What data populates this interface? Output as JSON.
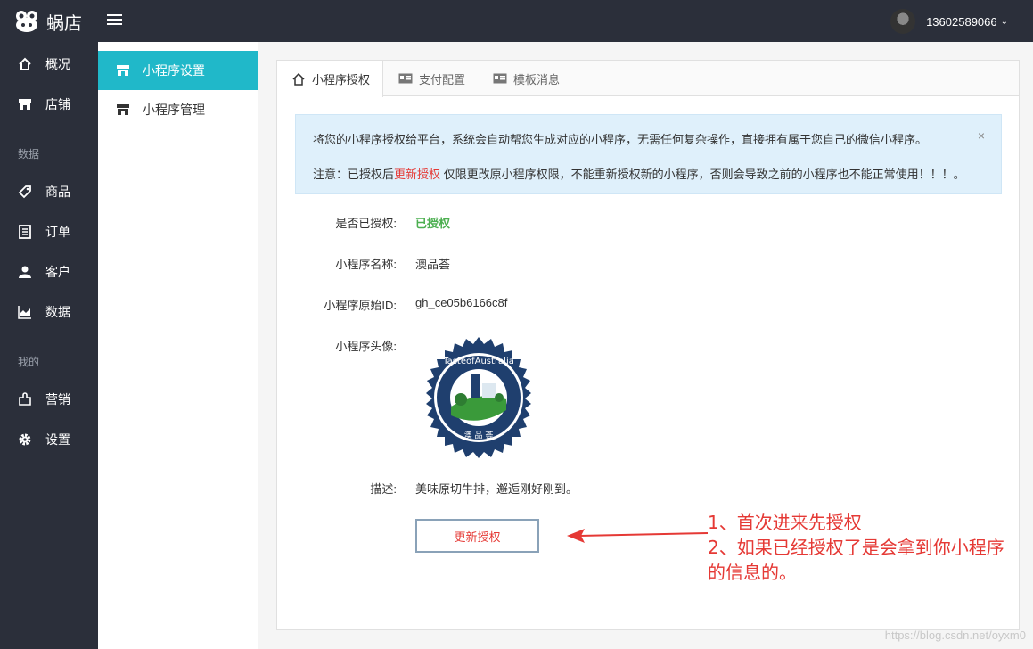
{
  "app": {
    "name": "蜗店"
  },
  "user": {
    "phone": "13602589066"
  },
  "sidebar": {
    "items": [
      {
        "label": "概况",
        "icon": "home-icon"
      },
      {
        "label": "店铺",
        "icon": "store-icon"
      }
    ],
    "section_data": "数据",
    "data_items": [
      {
        "label": "商品",
        "icon": "tag-icon"
      },
      {
        "label": "订单",
        "icon": "order-icon"
      },
      {
        "label": "客户",
        "icon": "user-icon"
      },
      {
        "label": "数据",
        "icon": "chart-icon"
      }
    ],
    "section_mine": "我的",
    "mine_items": [
      {
        "label": "营销",
        "icon": "puzzle-icon"
      },
      {
        "label": "设置",
        "icon": "gear-icon"
      }
    ]
  },
  "subnav": {
    "items": [
      {
        "label": "小程序设置",
        "active": true
      },
      {
        "label": "小程序管理",
        "active": false
      }
    ]
  },
  "tabs": [
    {
      "label": "小程序授权",
      "icon": "home-icon",
      "active": true
    },
    {
      "label": "支付配置",
      "icon": "card-icon",
      "active": false
    },
    {
      "label": "模板消息",
      "icon": "card-icon",
      "active": false
    }
  ],
  "alert": {
    "line1": "将您的小程序授权给平台，系统会自动帮您生成对应的小程序，无需任何复杂操作，直接拥有属于您自己的微信小程序。",
    "line2_prefix": "注意：已授权后",
    "line2_highlight": "更新授权",
    "line2_suffix": " 仅限更改原小程序权限，不能重新授权新的小程序，否则会导致之前的小程序也不能正常使用！！！。",
    "close": "×"
  },
  "fields": {
    "authorized_label": "是否已授权:",
    "authorized_value": "已授权",
    "name_label": "小程序名称:",
    "name_value": "澳品荟",
    "id_label": "小程序原始ID:",
    "id_value": "gh_ce05b6166c8f",
    "avatar_label": "小程序头像:",
    "desc_label": "描述:",
    "desc_value": "美味原切牛排，邂逅刚好刚到。"
  },
  "avatar_seal": {
    "ring_text": "TasteofAustralia",
    "bottom_text": "澳 品 荟"
  },
  "renew_button": "更新授权",
  "annotation": {
    "line1": "1、首次进来先授权",
    "line2": "2、如果已经授权了是会拿到你小程序",
    "line3": "的信息的。"
  },
  "watermark": "https://blog.csdn.net/oyxm0",
  "colors": {
    "sidebar_bg": "#2b2f3a",
    "accent": "#20b8c9",
    "alert_bg": "#dff0fb",
    "red": "#e53935",
    "green": "#4caf50"
  }
}
